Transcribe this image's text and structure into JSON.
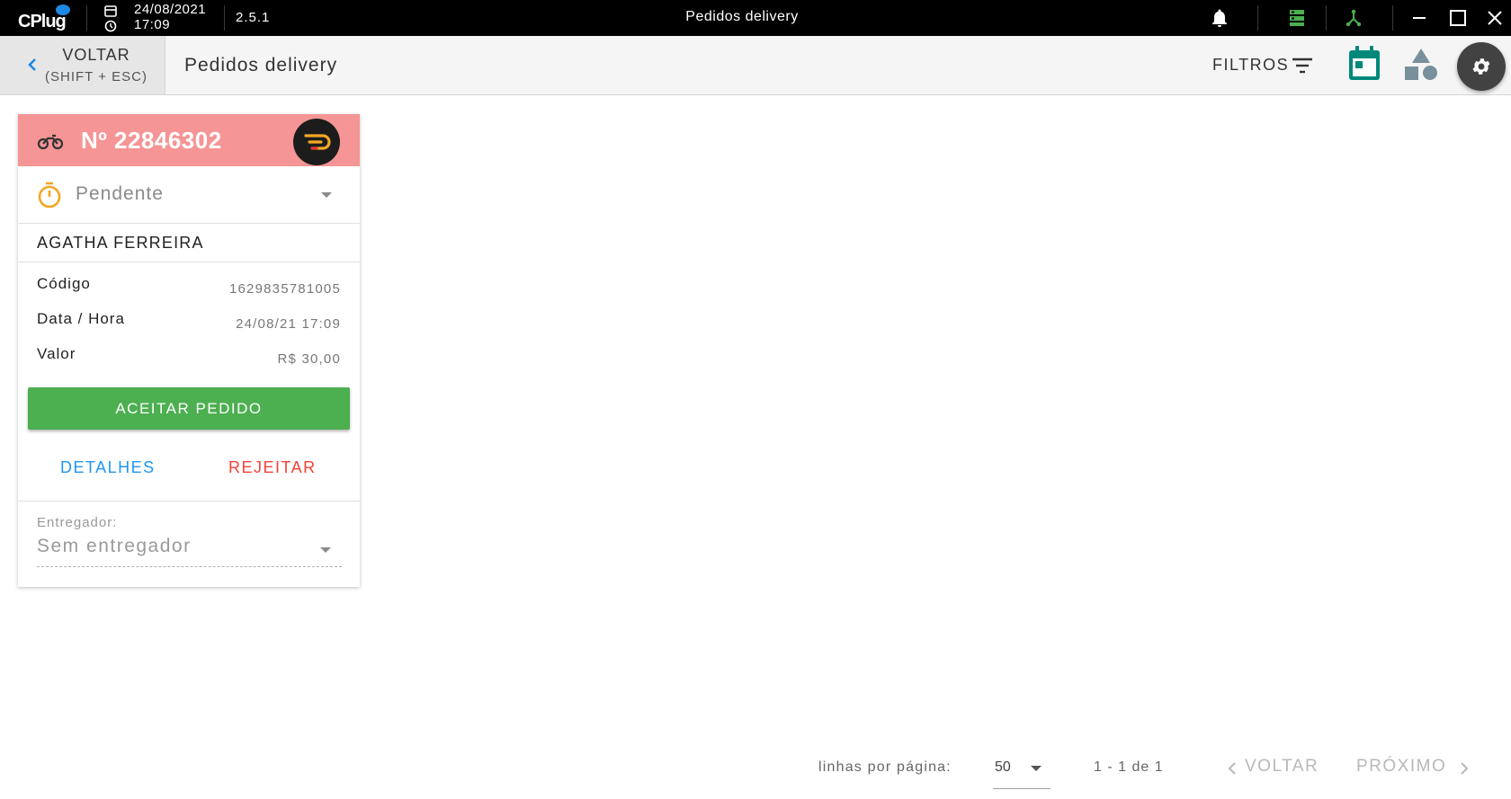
{
  "titlebar": {
    "logo": "CPlug",
    "date": "24/08/2021",
    "time": "17:09",
    "version": "2.5.1",
    "title": "Pedidos delivery",
    "icons": [
      "bell-icon",
      "server-icon",
      "network-icon",
      "minimize-icon",
      "maximize-icon",
      "close-icon"
    ]
  },
  "header": {
    "back_label": "VOLTAR",
    "back_shortcut": "(SHIFT + ESC)",
    "title": "Pedidos delivery",
    "filters_label": "FILTROS"
  },
  "order": {
    "number": "Nº 22846302",
    "status": "Pendente",
    "customer": "AGATHA FERREIRA",
    "code_label": "Código",
    "code_value": "1629835781005",
    "datetime_label": "Data / Hora",
    "datetime_value": "24/08/21 17:09",
    "value_label": "Valor",
    "value_value": "R$ 30,00",
    "accept_label": "ACEITAR PEDIDO",
    "details_label": "DETALHES",
    "reject_label": "REJEITAR",
    "courier_label": "Entregador:",
    "courier_value": "Sem entregador"
  },
  "pagination": {
    "rows_label": "linhas por página:",
    "rows_value": "50",
    "range": "1 - 1 de 1",
    "prev_label": "VOLTAR",
    "next_label": "PRÓXIMO"
  },
  "colors": {
    "header_bar": "#000000",
    "card_header": "#f59595",
    "accept_button": "#4caf50",
    "details_link": "#2196f3",
    "reject_link": "#f44336",
    "status_icon": "#f5a623",
    "calendar_icon": "#00897b"
  }
}
